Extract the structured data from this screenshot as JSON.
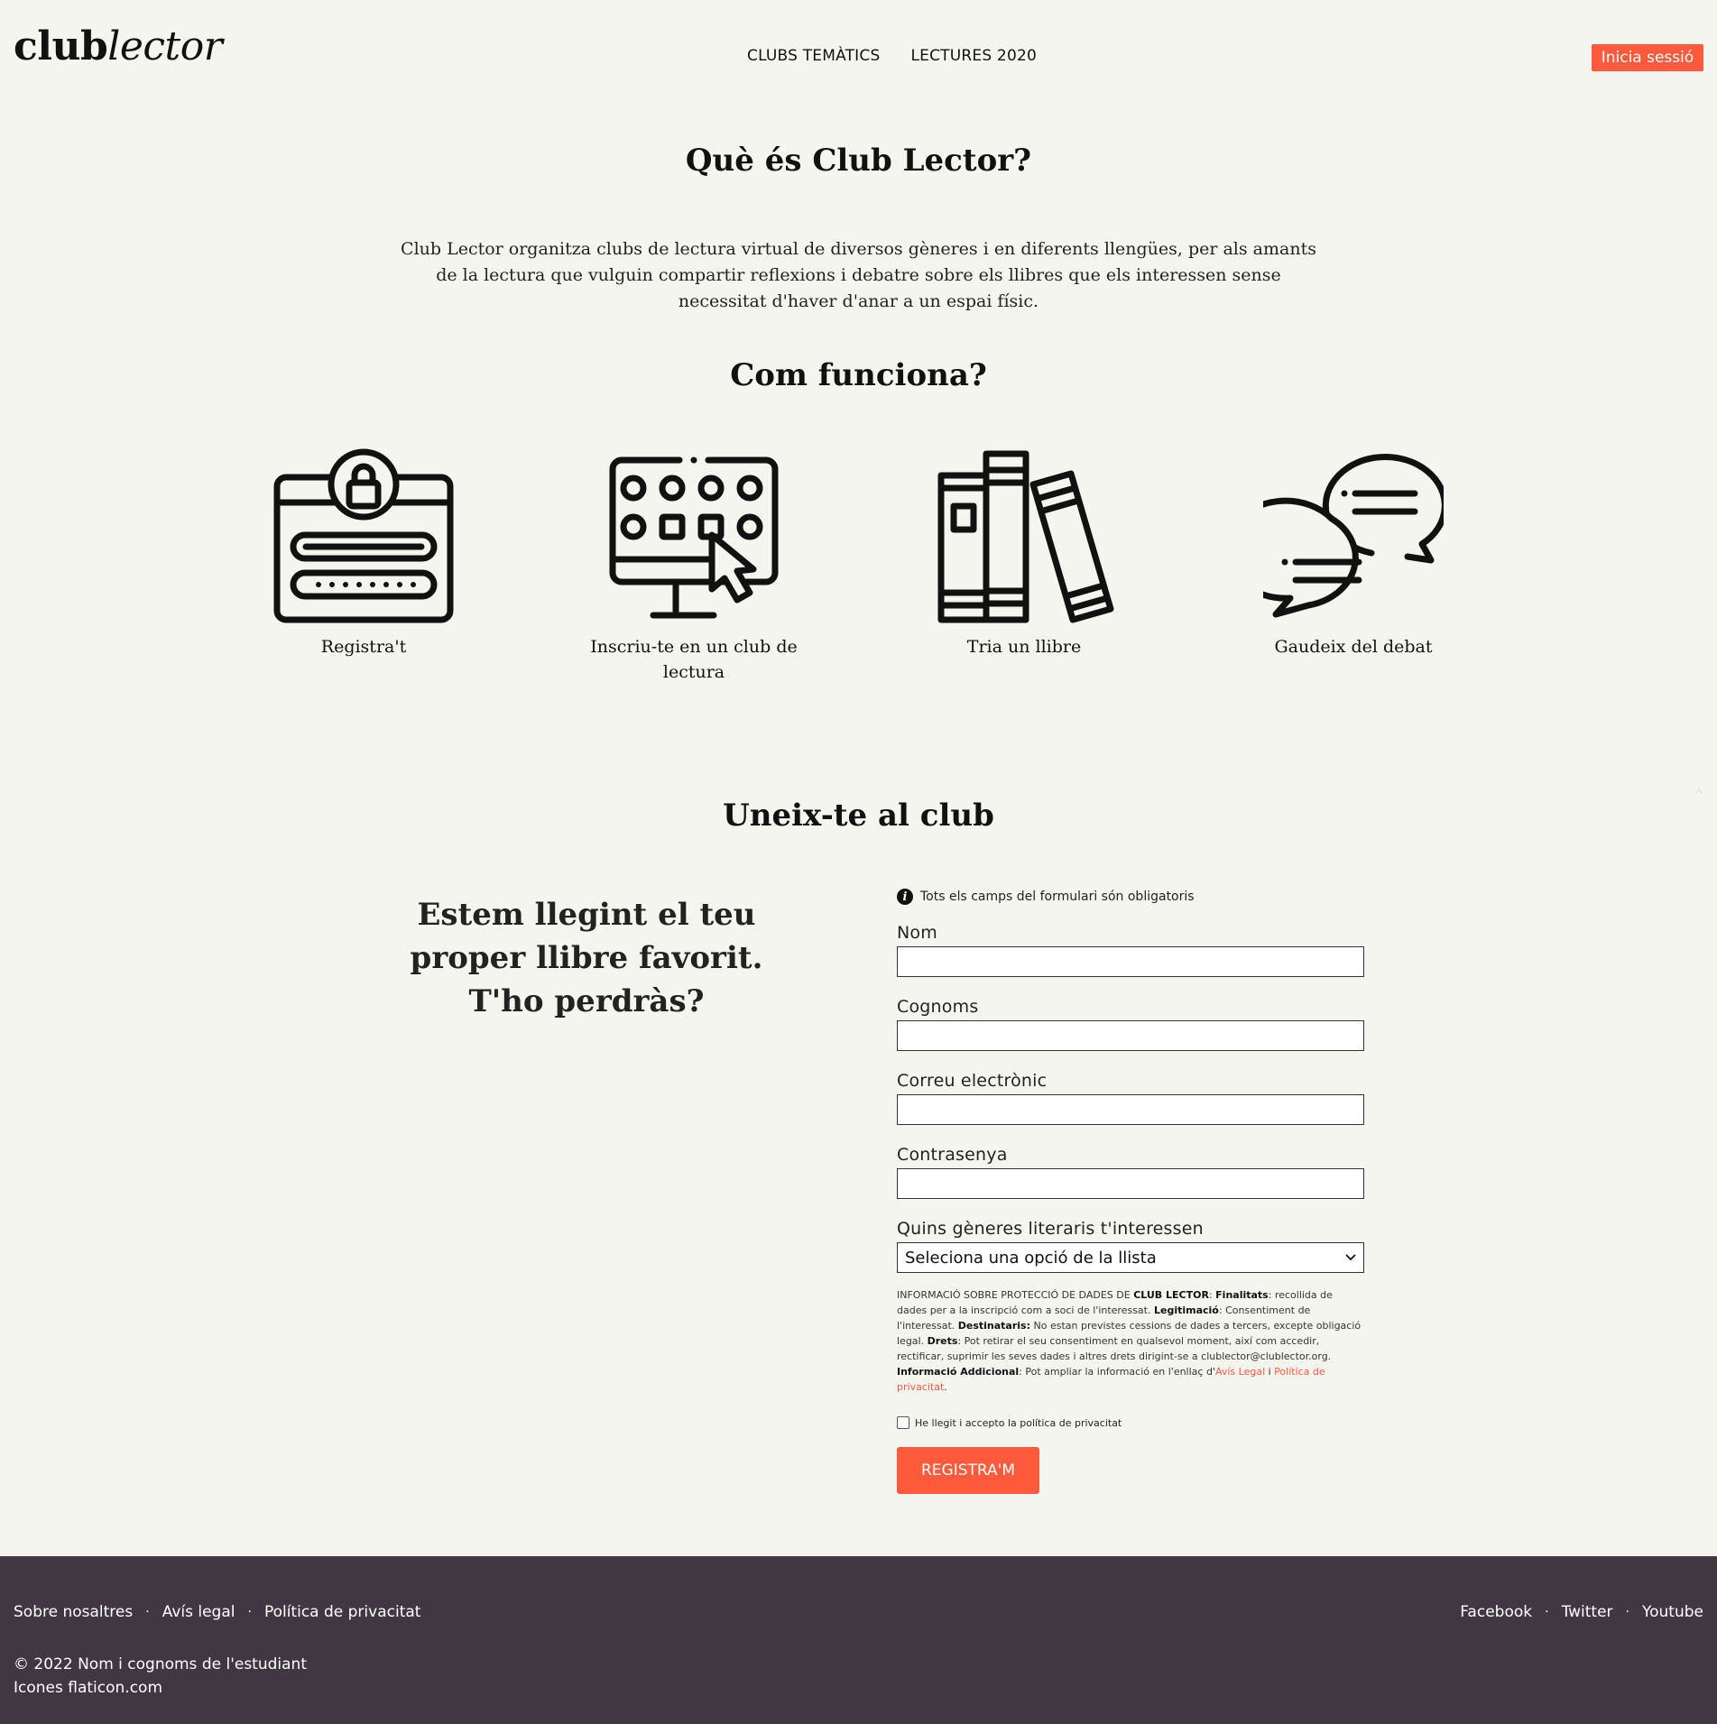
{
  "header": {
    "logo_bold": "club",
    "logo_italic": "lector",
    "nav": [
      "CLUBS TEMÀTICS",
      "LECTURES 2020"
    ],
    "login_label": "Inicia sessió"
  },
  "about": {
    "title": "Què és Club Lector?",
    "text": "Club Lector organitza clubs de lectura virtual de diversos gèneres i en diferents llengües, per als amants de la lectura que vulguin compartir reflexions i debatre sobre els llibres que els interessen sense necessitat d'haver d'anar a un espai físic."
  },
  "how": {
    "title": "Com funciona?",
    "steps": [
      {
        "icon": "login-form-icon",
        "label": "Registra't"
      },
      {
        "icon": "monitor-click-icon",
        "label": "Inscriu-te en un club de lectura"
      },
      {
        "icon": "books-icon",
        "label": "Tria un llibre"
      },
      {
        "icon": "chat-bubbles-icon",
        "label": "Gaudeix del debat"
      }
    ]
  },
  "join": {
    "title": "Uneix-te al club",
    "tagline": "Estem llegint el teu proper llibre favorit. T'ho perdràs?"
  },
  "form": {
    "note": "Tots els camps del formulari són obligatoris",
    "name_label": "Nom",
    "surname_label": "Cognoms",
    "email_label": "Correu electrònic",
    "password_label": "Contrasenya",
    "genres_label": "Quins gèneres literaris t'interessen",
    "genres_selected": "Seleciona una opció de la llista",
    "legal": {
      "intro": "INFORMACIÓ SOBRE PROTECCIÓ DE DADES DE ",
      "brand": "CLUB LECTOR",
      "purpose_label": "Finalitats",
      "purpose": ": recollida de dades per a la inscripció com a soci de l'interessat. ",
      "legitimacy_label": "Legitimació",
      "legitimacy": ": Consentiment de l'interessat. ",
      "recipients_label": "Destinataris:",
      "recipients": " No estan previstes cessions de dades a tercers, excepte obligació legal. ",
      "rights_label": "Drets",
      "rights": ": Pot retirar el seu consentiment en qualsevol moment, així com accedir, rectificar, suprimir les seves dades i altres drets dirigint-se a clublector@clublector.org. ",
      "additional_label": "Informació Addicional",
      "additional": ": Pot ampliar la informació en l'enllaç d'",
      "legal_link": "Avís Legal",
      "and": " i ",
      "privacy_link": "Política de privacitat",
      "end": "."
    },
    "accept_label": "He llegit i accepto la política de privacitat",
    "submit_label": "REGISTRA'M"
  },
  "footer": {
    "links": [
      "Sobre nosaltres",
      "Avís legal",
      "Política de privacitat"
    ],
    "social": [
      "Facebook",
      "Twitter",
      "Youtube"
    ],
    "separator": "·",
    "copyright": "© 2022 Nom i cognoms de l'estudiant",
    "credits": "Icones flaticon.com"
  },
  "colors": {
    "accent": "#ff5a3c",
    "background": "#f5f5f0",
    "footer": "#413742"
  }
}
